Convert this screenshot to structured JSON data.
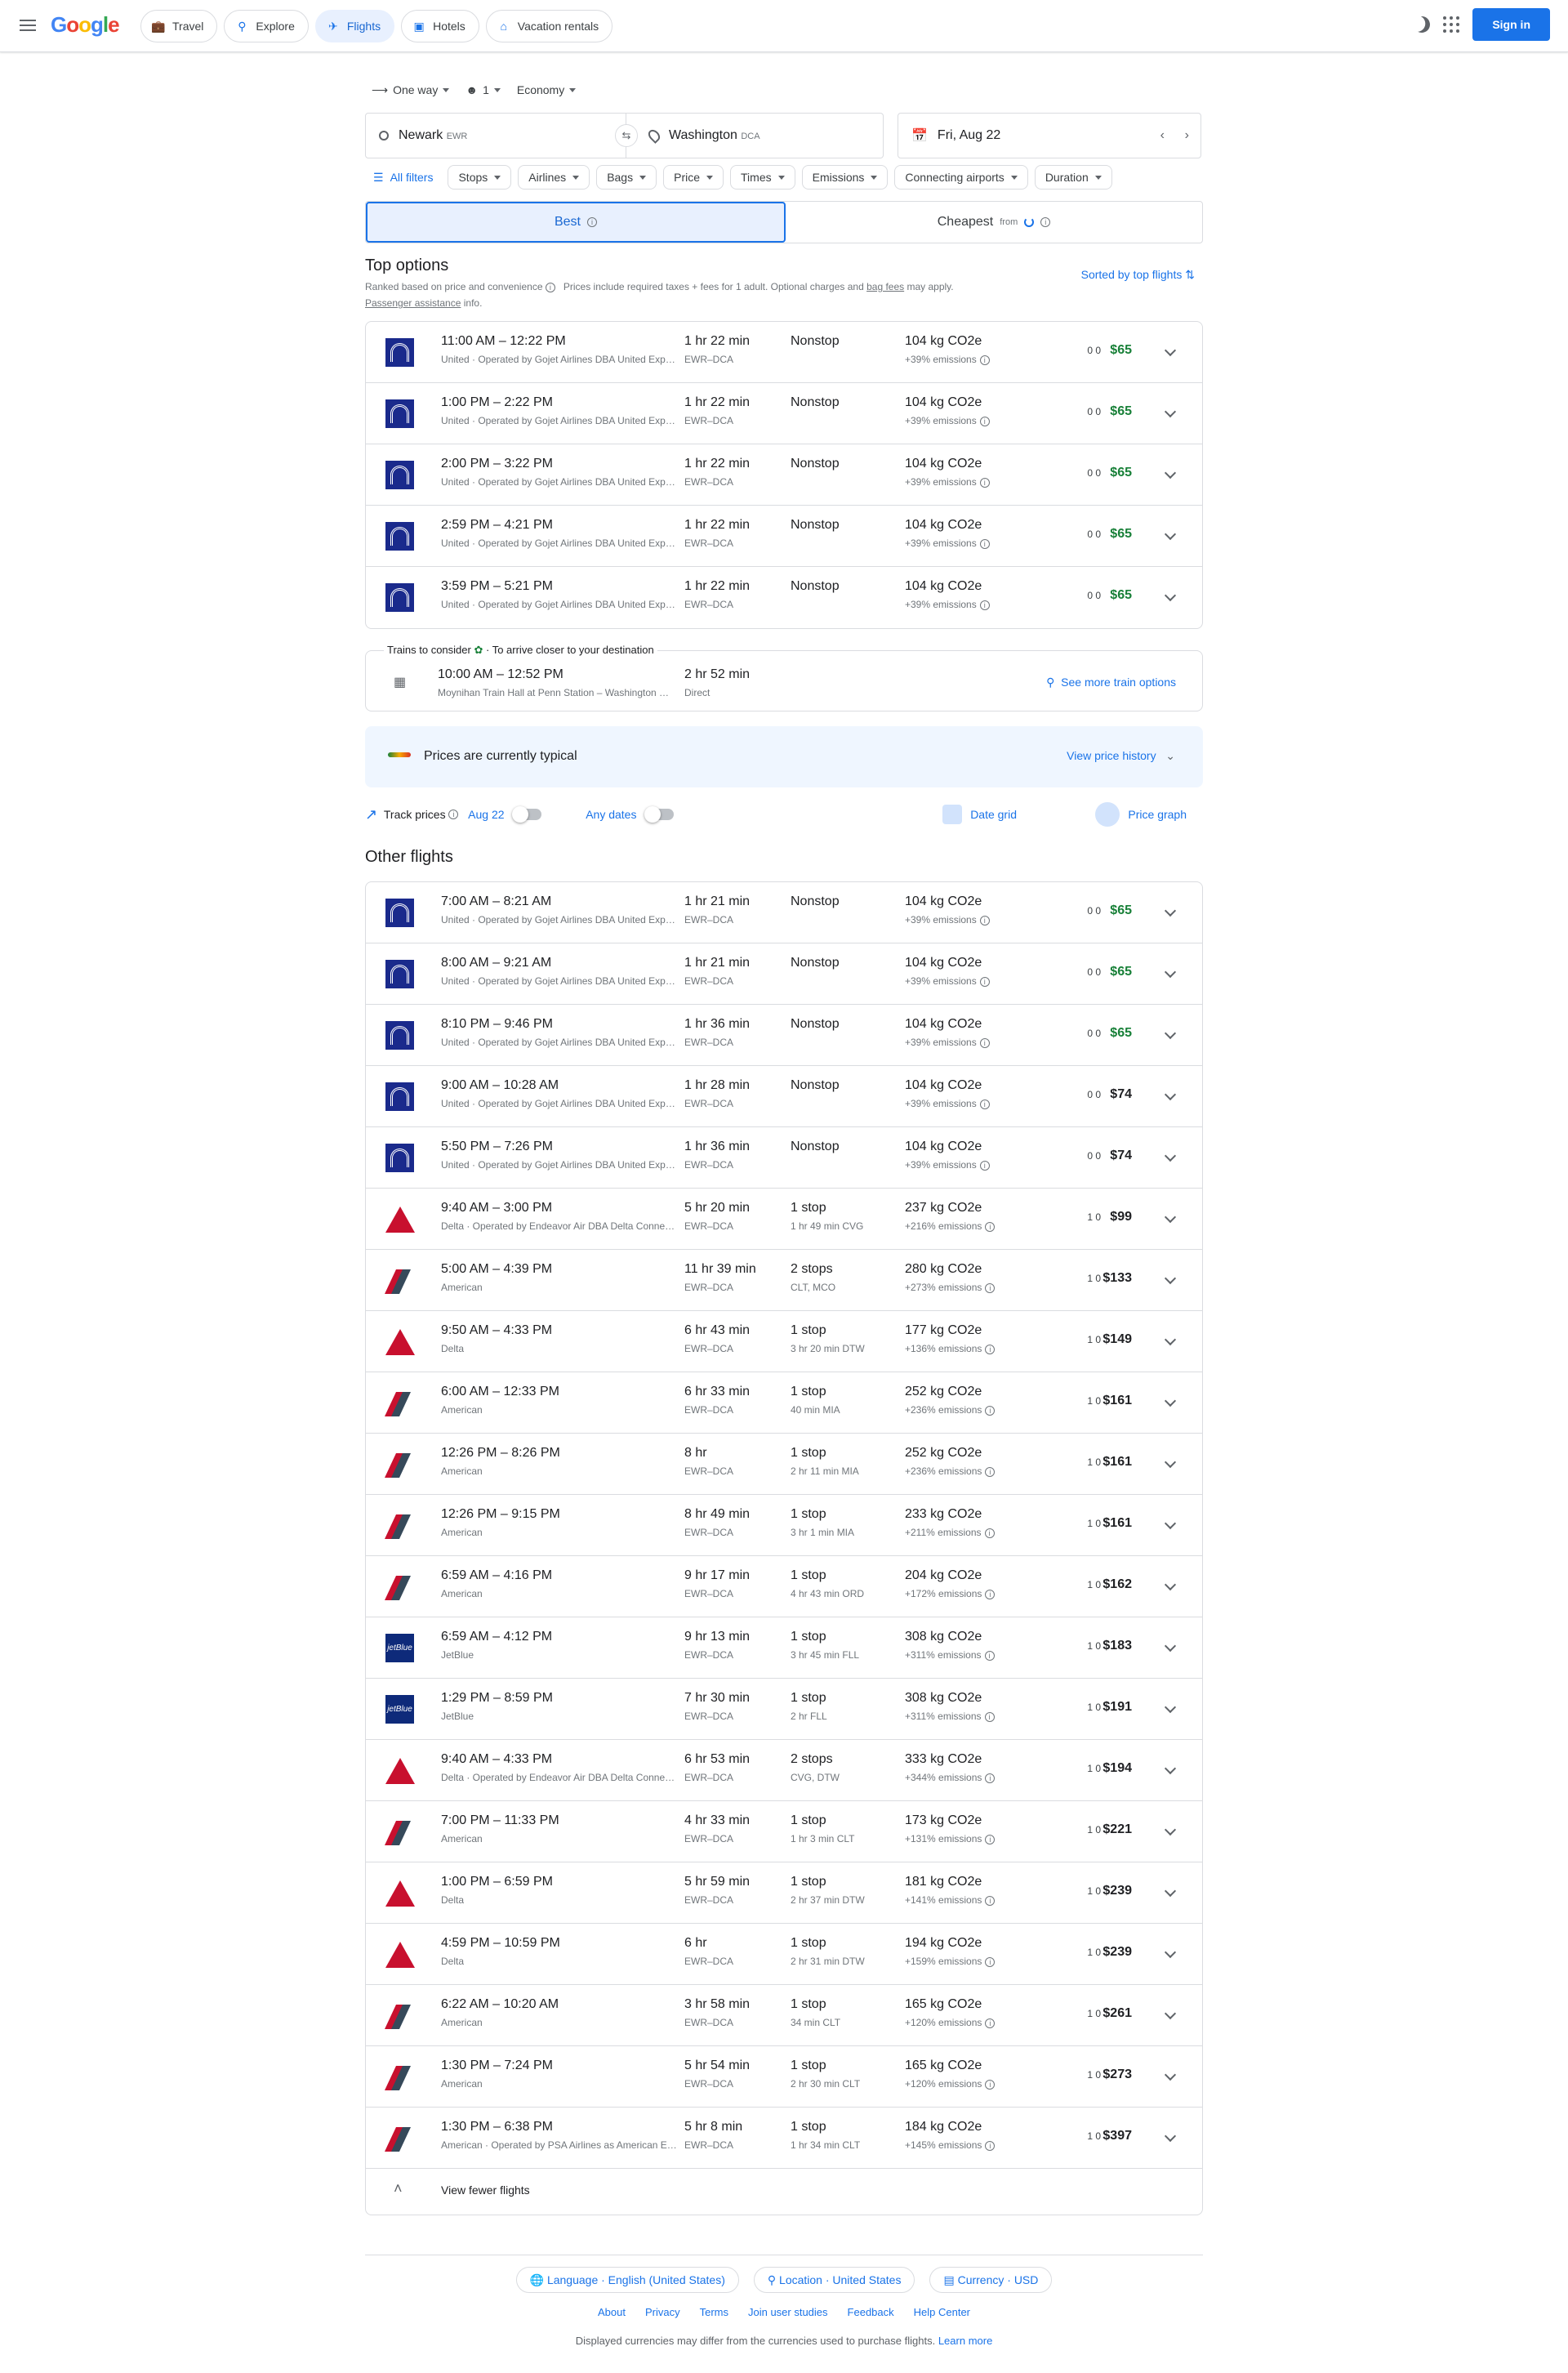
{
  "header": {
    "logo": "Google",
    "tabs": [
      {
        "label": "Travel",
        "icon": "travel-icon"
      },
      {
        "label": "Explore",
        "icon": "explore-icon"
      },
      {
        "label": "Flights",
        "icon": "flights-icon"
      },
      {
        "label": "Hotels",
        "icon": "hotels-icon"
      },
      {
        "label": "Vacation rentals",
        "icon": "vacation-rentals-icon"
      }
    ],
    "sign_in": "Sign in"
  },
  "search": {
    "trip_type": "One way",
    "passengers": "1",
    "cabin": "Economy",
    "origin": "Newark",
    "origin_code": "EWR",
    "destination": "Washington",
    "destination_code": "DCA",
    "date": "Fri, Aug 22"
  },
  "filters": {
    "all": "All filters",
    "chips": [
      "Stops",
      "Airlines",
      "Bags",
      "Price",
      "Times",
      "Emissions",
      "Connecting airports",
      "Duration"
    ]
  },
  "sort": {
    "best": "Best",
    "cheapest": "Cheapest",
    "cheapest_from": "from"
  },
  "top": {
    "title": "Top options",
    "ranked": "Ranked based on price and convenience",
    "prices_note": "Prices include required taxes + fees for 1 adult. Optional charges and",
    "bag_fees": "bag fees",
    "may_apply": "may apply.",
    "passenger_assistance": "Passenger assistance",
    "info": "info.",
    "sorted": "Sorted by top flights"
  },
  "top_flights": [
    {
      "airline": "united",
      "time": "11:00 AM – 12:22 PM",
      "carrier": "United · Operated by Gojet Airlines DBA United Express",
      "duration": "1 hr 22 min",
      "route": "EWR–DCA",
      "stops": "Nonstop",
      "layover": "",
      "co2": "104 kg CO2e",
      "emissions": "+39% emissions",
      "bags": "0 0",
      "price": "$65",
      "green": true
    },
    {
      "airline": "united",
      "time": "1:00 PM – 2:22 PM",
      "carrier": "United · Operated by Gojet Airlines DBA United Express",
      "duration": "1 hr 22 min",
      "route": "EWR–DCA",
      "stops": "Nonstop",
      "layover": "",
      "co2": "104 kg CO2e",
      "emissions": "+39% emissions",
      "bags": "0 0",
      "price": "$65",
      "green": true
    },
    {
      "airline": "united",
      "time": "2:00 PM – 3:22 PM",
      "carrier": "United · Operated by Gojet Airlines DBA United Express",
      "duration": "1 hr 22 min",
      "route": "EWR–DCA",
      "stops": "Nonstop",
      "layover": "",
      "co2": "104 kg CO2e",
      "emissions": "+39% emissions",
      "bags": "0 0",
      "price": "$65",
      "green": true
    },
    {
      "airline": "united",
      "time": "2:59 PM – 4:21 PM",
      "carrier": "United · Operated by Gojet Airlines DBA United Express",
      "duration": "1 hr 22 min",
      "route": "EWR–DCA",
      "stops": "Nonstop",
      "layover": "",
      "co2": "104 kg CO2e",
      "emissions": "+39% emissions",
      "bags": "0 0",
      "price": "$65",
      "green": true
    },
    {
      "airline": "united",
      "time": "3:59 PM – 5:21 PM",
      "carrier": "United · Operated by Gojet Airlines DBA United Express",
      "duration": "1 hr 22 min",
      "route": "EWR–DCA",
      "stops": "Nonstop",
      "layover": "",
      "co2": "104 kg CO2e",
      "emissions": "+39% emissions",
      "bags": "0 0",
      "price": "$65",
      "green": true
    }
  ],
  "trains": {
    "label": "Trains to consider",
    "sub": "· To arrive closer to your destination",
    "time": "10:00 AM – 12:52 PM",
    "stations": "Moynihan Train Hall at Penn Station – Washington Union Station",
    "duration": "2 hr 52 min",
    "direct": "Direct",
    "more": "See more train options"
  },
  "insight": {
    "text_pre": "Prices are currently",
    "text_bold": "typical",
    "history": "View price history"
  },
  "track": {
    "label": "Track prices",
    "date": "Aug 22",
    "any": "Any dates",
    "grid": "Date grid",
    "graph": "Price graph"
  },
  "other": {
    "title": "Other flights"
  },
  "other_flights": [
    {
      "airline": "united",
      "time": "7:00 AM – 8:21 AM",
      "carrier": "United · Operated by Gojet Airlines DBA United Express",
      "duration": "1 hr 21 min",
      "route": "EWR–DCA",
      "stops": "Nonstop",
      "layover": "",
      "co2": "104 kg CO2e",
      "emissions": "+39% emissions",
      "bags": "0 0",
      "price": "$65",
      "green": true
    },
    {
      "airline": "united",
      "time": "8:00 AM – 9:21 AM",
      "carrier": "United · Operated by Gojet Airlines DBA United Express",
      "duration": "1 hr 21 min",
      "route": "EWR–DCA",
      "stops": "Nonstop",
      "layover": "",
      "co2": "104 kg CO2e",
      "emissions": "+39% emissions",
      "bags": "0 0",
      "price": "$65",
      "green": true
    },
    {
      "airline": "united",
      "time": "8:10 PM – 9:46 PM",
      "carrier": "United · Operated by Gojet Airlines DBA United Express",
      "duration": "1 hr 36 min",
      "route": "EWR–DCA",
      "stops": "Nonstop",
      "layover": "",
      "co2": "104 kg CO2e",
      "emissions": "+39% emissions",
      "bags": "0 0",
      "price": "$65",
      "green": true
    },
    {
      "airline": "united",
      "time": "9:00 AM – 10:28 AM",
      "carrier": "United · Operated by Gojet Airlines DBA United Express",
      "duration": "1 hr 28 min",
      "route": "EWR–DCA",
      "stops": "Nonstop",
      "layover": "",
      "co2": "104 kg CO2e",
      "emissions": "+39% emissions",
      "bags": "0 0",
      "price": "$74",
      "green": false
    },
    {
      "airline": "united",
      "time": "5:50 PM – 7:26 PM",
      "carrier": "United · Operated by Gojet Airlines DBA United Express",
      "duration": "1 hr 36 min",
      "route": "EWR–DCA",
      "stops": "Nonstop",
      "layover": "",
      "co2": "104 kg CO2e",
      "emissions": "+39% emissions",
      "bags": "0 0",
      "price": "$74",
      "green": false
    },
    {
      "airline": "delta",
      "time": "9:40 AM – 3:00 PM",
      "carrier": "Delta · Operated by Endeavor Air DBA Delta Connection",
      "duration": "5 hr 20 min",
      "route": "EWR–DCA",
      "stops": "1 stop",
      "layover": "1 hr 49 min CVG",
      "co2": "237 kg CO2e",
      "emissions": "+216% emissions",
      "bags": "1 0",
      "price": "$99",
      "green": false
    },
    {
      "airline": "american",
      "time": "5:00 AM – 4:39 PM",
      "carrier": "American",
      "duration": "11 hr 39 min",
      "route": "EWR–DCA",
      "stops": "2 stops",
      "layover": "CLT, MCO",
      "co2": "280 kg CO2e",
      "emissions": "+273% emissions",
      "bags": "1 0",
      "price": "$133",
      "green": false
    },
    {
      "airline": "delta",
      "time": "9:50 AM – 4:33 PM",
      "carrier": "Delta",
      "duration": "6 hr 43 min",
      "route": "EWR–DCA",
      "stops": "1 stop",
      "layover": "3 hr 20 min DTW",
      "co2": "177 kg CO2e",
      "emissions": "+136% emissions",
      "bags": "1 0",
      "price": "$149",
      "green": false
    },
    {
      "airline": "american",
      "time": "6:00 AM – 12:33 PM",
      "carrier": "American",
      "duration": "6 hr 33 min",
      "route": "EWR–DCA",
      "stops": "1 stop",
      "layover": "40 min MIA",
      "co2": "252 kg CO2e",
      "emissions": "+236% emissions",
      "bags": "1 0",
      "price": "$161",
      "green": false
    },
    {
      "airline": "american",
      "time": "12:26 PM – 8:26 PM",
      "carrier": "American",
      "duration": "8 hr",
      "route": "EWR–DCA",
      "stops": "1 stop",
      "layover": "2 hr 11 min MIA",
      "co2": "252 kg CO2e",
      "emissions": "+236% emissions",
      "bags": "1 0",
      "price": "$161",
      "green": false
    },
    {
      "airline": "american",
      "time": "12:26 PM – 9:15 PM",
      "carrier": "American",
      "duration": "8 hr 49 min",
      "route": "EWR–DCA",
      "stops": "1 stop",
      "layover": "3 hr 1 min MIA",
      "co2": "233 kg CO2e",
      "emissions": "+211% emissions",
      "bags": "1 0",
      "price": "$161",
      "green": false
    },
    {
      "airline": "american",
      "time": "6:59 AM – 4:16 PM",
      "carrier": "American",
      "duration": "9 hr 17 min",
      "route": "EWR–DCA",
      "stops": "1 stop",
      "layover": "4 hr 43 min ORD",
      "co2": "204 kg CO2e",
      "emissions": "+172% emissions",
      "bags": "1 0",
      "price": "$162",
      "green": false
    },
    {
      "airline": "jetblue",
      "time": "6:59 AM – 4:12 PM",
      "carrier": "JetBlue",
      "duration": "9 hr 13 min",
      "route": "EWR–DCA",
      "stops": "1 stop",
      "layover": "3 hr 45 min FLL",
      "co2": "308 kg CO2e",
      "emissions": "+311% emissions",
      "bags": "1 0",
      "price": "$183",
      "green": false
    },
    {
      "airline": "jetblue",
      "time": "1:29 PM – 8:59 PM",
      "carrier": "JetBlue",
      "duration": "7 hr 30 min",
      "route": "EWR–DCA",
      "stops": "1 stop",
      "layover": "2 hr FLL",
      "co2": "308 kg CO2e",
      "emissions": "+311% emissions",
      "bags": "1 0",
      "price": "$191",
      "green": false
    },
    {
      "airline": "delta",
      "time": "9:40 AM – 4:33 PM",
      "carrier": "Delta · Operated by Endeavor Air DBA Delta Connection",
      "duration": "6 hr 53 min",
      "route": "EWR–DCA",
      "stops": "2 stops",
      "layover": "CVG, DTW",
      "co2": "333 kg CO2e",
      "emissions": "+344% emissions",
      "bags": "1 0",
      "price": "$194",
      "green": false
    },
    {
      "airline": "american",
      "time": "7:00 PM – 11:33 PM",
      "carrier": "American",
      "duration": "4 hr 33 min",
      "route": "EWR–DCA",
      "stops": "1 stop",
      "layover": "1 hr 3 min CLT",
      "co2": "173 kg CO2e",
      "emissions": "+131% emissions",
      "bags": "1 0",
      "price": "$221",
      "green": false
    },
    {
      "airline": "delta",
      "time": "1:00 PM – 6:59 PM",
      "carrier": "Delta",
      "duration": "5 hr 59 min",
      "route": "EWR–DCA",
      "stops": "1 stop",
      "layover": "2 hr 37 min DTW",
      "co2": "181 kg CO2e",
      "emissions": "+141% emissions",
      "bags": "1 0",
      "price": "$239",
      "green": false
    },
    {
      "airline": "delta",
      "time": "4:59 PM – 10:59 PM",
      "carrier": "Delta",
      "duration": "6 hr",
      "route": "EWR–DCA",
      "stops": "1 stop",
      "layover": "2 hr 31 min DTW",
      "co2": "194 kg CO2e",
      "emissions": "+159% emissions",
      "bags": "1 0",
      "price": "$239",
      "green": false
    },
    {
      "airline": "american",
      "time": "6:22 AM – 10:20 AM",
      "carrier": "American",
      "duration": "3 hr 58 min",
      "route": "EWR–DCA",
      "stops": "1 stop",
      "layover": "34 min CLT",
      "co2": "165 kg CO2e",
      "emissions": "+120% emissions",
      "bags": "1 0",
      "price": "$261",
      "green": false
    },
    {
      "airline": "american",
      "time": "1:30 PM – 7:24 PM",
      "carrier": "American",
      "duration": "5 hr 54 min",
      "route": "EWR–DCA",
      "stops": "1 stop",
      "layover": "2 hr 30 min CLT",
      "co2": "165 kg CO2e",
      "emissions": "+120% emissions",
      "bags": "1 0",
      "price": "$273",
      "green": false
    },
    {
      "airline": "american",
      "time": "1:30 PM – 6:38 PM",
      "carrier": "American · Operated by PSA Airlines as American Eagle",
      "duration": "5 hr 8 min",
      "route": "EWR–DCA",
      "stops": "1 stop",
      "layover": "1 hr 34 min CLT",
      "co2": "184 kg CO2e",
      "emissions": "+145% emissions",
      "bags": "1 0",
      "price": "$397",
      "green": false
    }
  ],
  "fewer": "View fewer flights",
  "footer": {
    "language": "Language · English (United States)",
    "location": "Location · United States",
    "currency": "Currency · USD",
    "links": [
      "About",
      "Privacy",
      "Terms",
      "Join user studies",
      "Feedback",
      "Help Center"
    ],
    "note": "Displayed currencies may differ from the currencies used to purchase flights.",
    "learn_more": "Learn more"
  },
  "colors": {
    "primary": "#1a73e8",
    "green_price": "#188038",
    "united": "#1a2a8c",
    "delta": "#c8102e",
    "jetblue": "#0e2a7a"
  }
}
